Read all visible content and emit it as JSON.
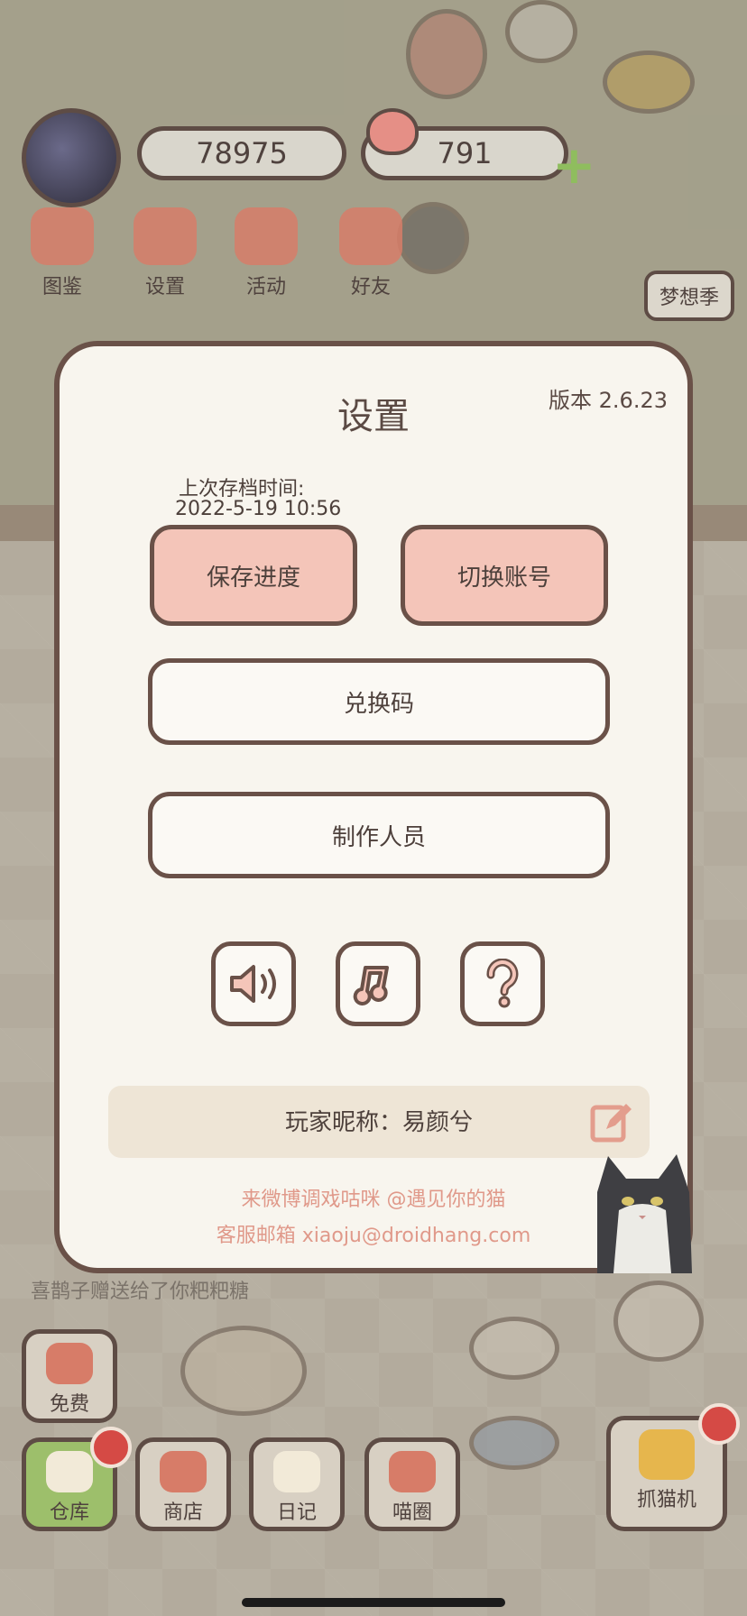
{
  "hud": {
    "coins": "78975",
    "hearts": "791"
  },
  "top_menu": [
    {
      "label": "图鉴"
    },
    {
      "label": "设置"
    },
    {
      "label": "活动"
    },
    {
      "label": "好友"
    }
  ],
  "season_button": "梦想季",
  "feed_text": "喜鹊子赠送给了你粑粑糖",
  "bottom_bar": [
    {
      "label": "免费"
    },
    {
      "label": "仓库"
    },
    {
      "label": "商店"
    },
    {
      "label": "日记"
    },
    {
      "label": "喵圈"
    },
    {
      "label": "抓猫机"
    }
  ],
  "dialog": {
    "title": "设置",
    "version": "版本 2.6.23",
    "last_save_label": "上次存档时间:",
    "last_save_value": "2022-5-19 10:56",
    "save_progress": "保存进度",
    "switch_account": "切换账号",
    "redeem_code": "兑换码",
    "credits": "制作人员",
    "nickname": "玩家昵称：易颜兮",
    "weibo": "来微博调戏咕咪 @遇见你的猫",
    "support_email": "客服邮箱 xiaoju@droidhang.com",
    "icons": [
      "sound-icon",
      "music-icon",
      "help-icon",
      "edit-icon"
    ]
  },
  "colors": {
    "accent_pink": "#f4c5b9",
    "border_brown": "#6a5148",
    "link_salmon": "#e0998a"
  }
}
